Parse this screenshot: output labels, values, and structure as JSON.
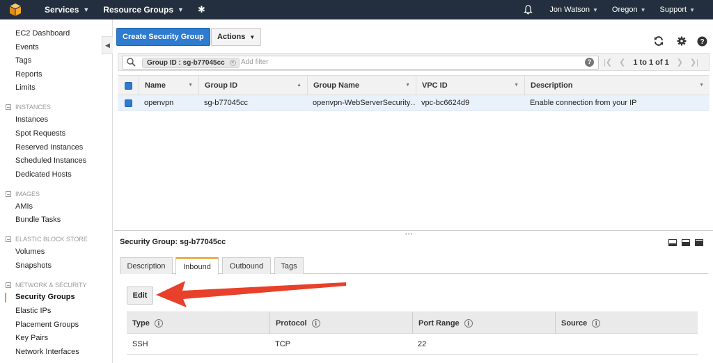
{
  "topbar": {
    "services": "Services",
    "resource_groups": "Resource Groups",
    "user": "Jon Watson",
    "region": "Oregon",
    "support": "Support"
  },
  "sidebar": {
    "items_top": [
      "EC2 Dashboard",
      "Events",
      "Tags",
      "Reports",
      "Limits"
    ],
    "instances_header": "INSTANCES",
    "instances": [
      "Instances",
      "Spot Requests",
      "Reserved Instances",
      "Scheduled Instances",
      "Dedicated Hosts"
    ],
    "images_header": "IMAGES",
    "images": [
      "AMIs",
      "Bundle Tasks"
    ],
    "ebs_header": "ELASTIC BLOCK STORE",
    "ebs": [
      "Volumes",
      "Snapshots"
    ],
    "network_header": "NETWORK & SECURITY",
    "network": [
      "Security Groups",
      "Elastic IPs",
      "Placement Groups",
      "Key Pairs",
      "Network Interfaces"
    ],
    "active": "Security Groups"
  },
  "toolbar": {
    "create_label": "Create Security Group",
    "actions_label": "Actions"
  },
  "filter": {
    "chip": "Group ID : sg-b77045cc",
    "placeholder": "Add filter",
    "pager_text": "1 to 1 of 1"
  },
  "table": {
    "columns": [
      "Name",
      "Group ID",
      "Group Name",
      "VPC ID",
      "Description"
    ],
    "rows": [
      [
        "openvpn",
        "sg-b77045cc",
        "openvpn-WebServerSecurity…",
        "vpc-bc6624d9",
        "Enable connection from your IP"
      ]
    ]
  },
  "detail": {
    "title": "Security Group: sg-b77045cc",
    "tabs": [
      "Description",
      "Inbound",
      "Outbound",
      "Tags"
    ],
    "active_tab": "Inbound",
    "edit_label": "Edit",
    "rule_columns": [
      "Type",
      "Protocol",
      "Port Range",
      "Source"
    ],
    "rules": [
      [
        "SSH",
        "TCP",
        "22",
        ""
      ]
    ]
  },
  "colors": {
    "topbar": "#232f3e",
    "primary": "#2e7bcf",
    "accent": "#e59b1b",
    "arrow": "#e8402a"
  },
  "icons": [
    "aws-cube-icon",
    "pin-icon",
    "bell-icon",
    "refresh-icon",
    "gear-icon",
    "help-icon",
    "search-icon"
  ]
}
